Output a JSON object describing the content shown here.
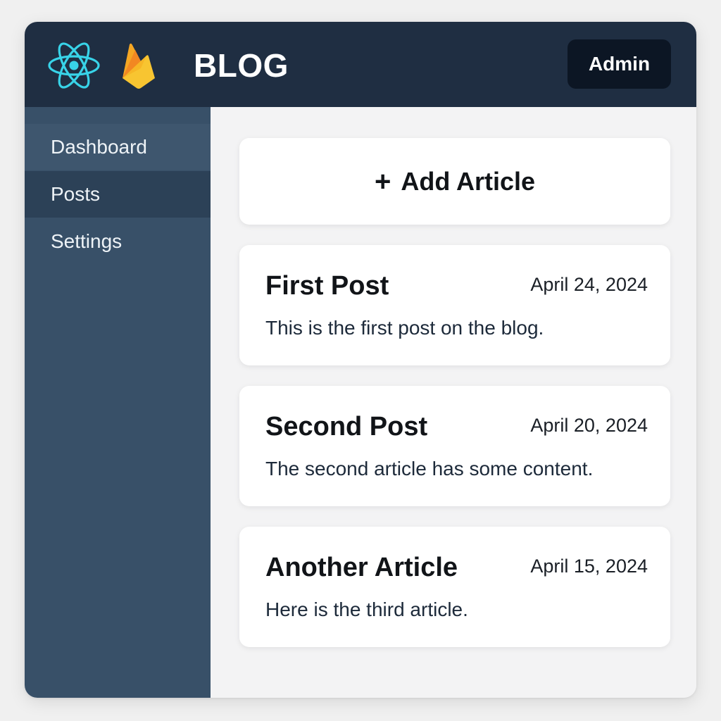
{
  "header": {
    "title": "BLOG",
    "admin_label": "Admin",
    "logos": [
      "react-logo",
      "firebase-logo"
    ]
  },
  "sidebar": {
    "items": [
      {
        "label": "Dashboard"
      },
      {
        "label": "Posts",
        "active": true
      },
      {
        "label": "Settings"
      }
    ]
  },
  "main": {
    "add_article": {
      "icon": "plus-icon",
      "label": "Add Article"
    },
    "posts": [
      {
        "title": "First Post",
        "date": "April 24, 2024",
        "excerpt": "This is the first post on the blog."
      },
      {
        "title": "Second Post",
        "date": "April 20, 2024",
        "excerpt": "The second article has some content."
      },
      {
        "title": "Another Article",
        "date": "April 15, 2024",
        "excerpt": "Here is the third article."
      }
    ]
  },
  "colors": {
    "header_bg": "#1f2e42",
    "sidebar_bg": "#385068",
    "sidebar_active_bg": "#2c4157",
    "admin_button_bg": "#0c1624",
    "react_cyan": "#38d3e8",
    "firebase_yellow": "#f8b82a",
    "firebase_orange": "#f28722"
  }
}
